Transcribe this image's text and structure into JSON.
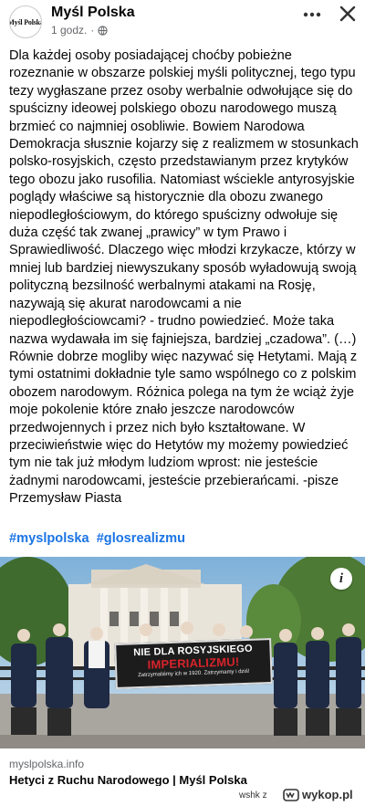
{
  "post": {
    "author": "Myśl Polska",
    "avatar_text": "Myśl Polska",
    "time": "1 godz.",
    "separator": "·",
    "paragraphs": [
      "Dla każdej osoby posiadającej choćby pobieżne rozeznanie w obszarze polskiej myśli politycznej, tego typu tezy wygłaszane przez osoby werbalnie odwołujące się do spuścizny ideowej  polskiego obozu narodowego muszą brzmieć co najmniej osobliwie. Bowiem Narodowa Demokracja słusznie kojarzy się z realizmem w stosunkach polsko-rosyjskich, często przedstawianym przez krytyków tego obozu jako rusofilia. Natomiast wściekle antyrosyjskie poglądy właściwe są historycznie dla obozu zwanego niepodległościowym, do którego spuścizny odwołuje się duża część tak zwanej „prawicy” w tym Prawo i Sprawiedliwość. Dlaczego więc młodzi krzykacze, którzy w mniej lub bardziej niewyszukany sposób wyładowują swoją polityczną bezsilność werbalnymi atakami na Rosję, nazywają się akurat narodowcami a nie niepodległościowcami? - trudno powiedzieć. Może taka nazwa wydawała im się fajniejsza, bardziej „czadowa”. (…)",
      "Równie dobrze mogliby więc nazywać się Hetytami. Mają z tymi ostatnimi dokładnie tyle samo wspólnego co z polskim obozem narodowym.  Różnica polega na tym że wciąż żyje moje pokolenie które znało jeszcze narodowców przedwojennych i przez nich było kształtowane. W przeciwieństwie więc do Hetytów my możemy powiedzieć tym nie tak już młodym ludziom wprost: nie jesteście żadnymi narodowcami, jesteście przebierańcami. -pisze Przemysław Piasta"
    ],
    "hashtags": [
      "#myslpolska",
      "#glosrealizmu"
    ]
  },
  "link_preview": {
    "banner_line1": "NIE DLA ROSYJSKIEGO",
    "banner_line2": "IMPERIALIZMU!",
    "banner_line3": "Zatrzymaliśmy ich w 1920. Zatrzymamy i dziś!",
    "info_label": "i",
    "domain": "myslpolska.info",
    "title": "Hetyci z Ruchu Narodowego | Myśl Polska"
  },
  "watermark": {
    "user": "wshk",
    "sep": "z",
    "site": "wykop.pl"
  },
  "icons": {
    "globe": "globe-icon",
    "more": "more-icon",
    "close": "close-icon",
    "info": "info-icon",
    "wykop_logo": "wykop-logo-icon"
  },
  "colors": {
    "hashtag": "#1b74e4",
    "meta": "#65676b",
    "banner_accent": "#d8232a"
  }
}
